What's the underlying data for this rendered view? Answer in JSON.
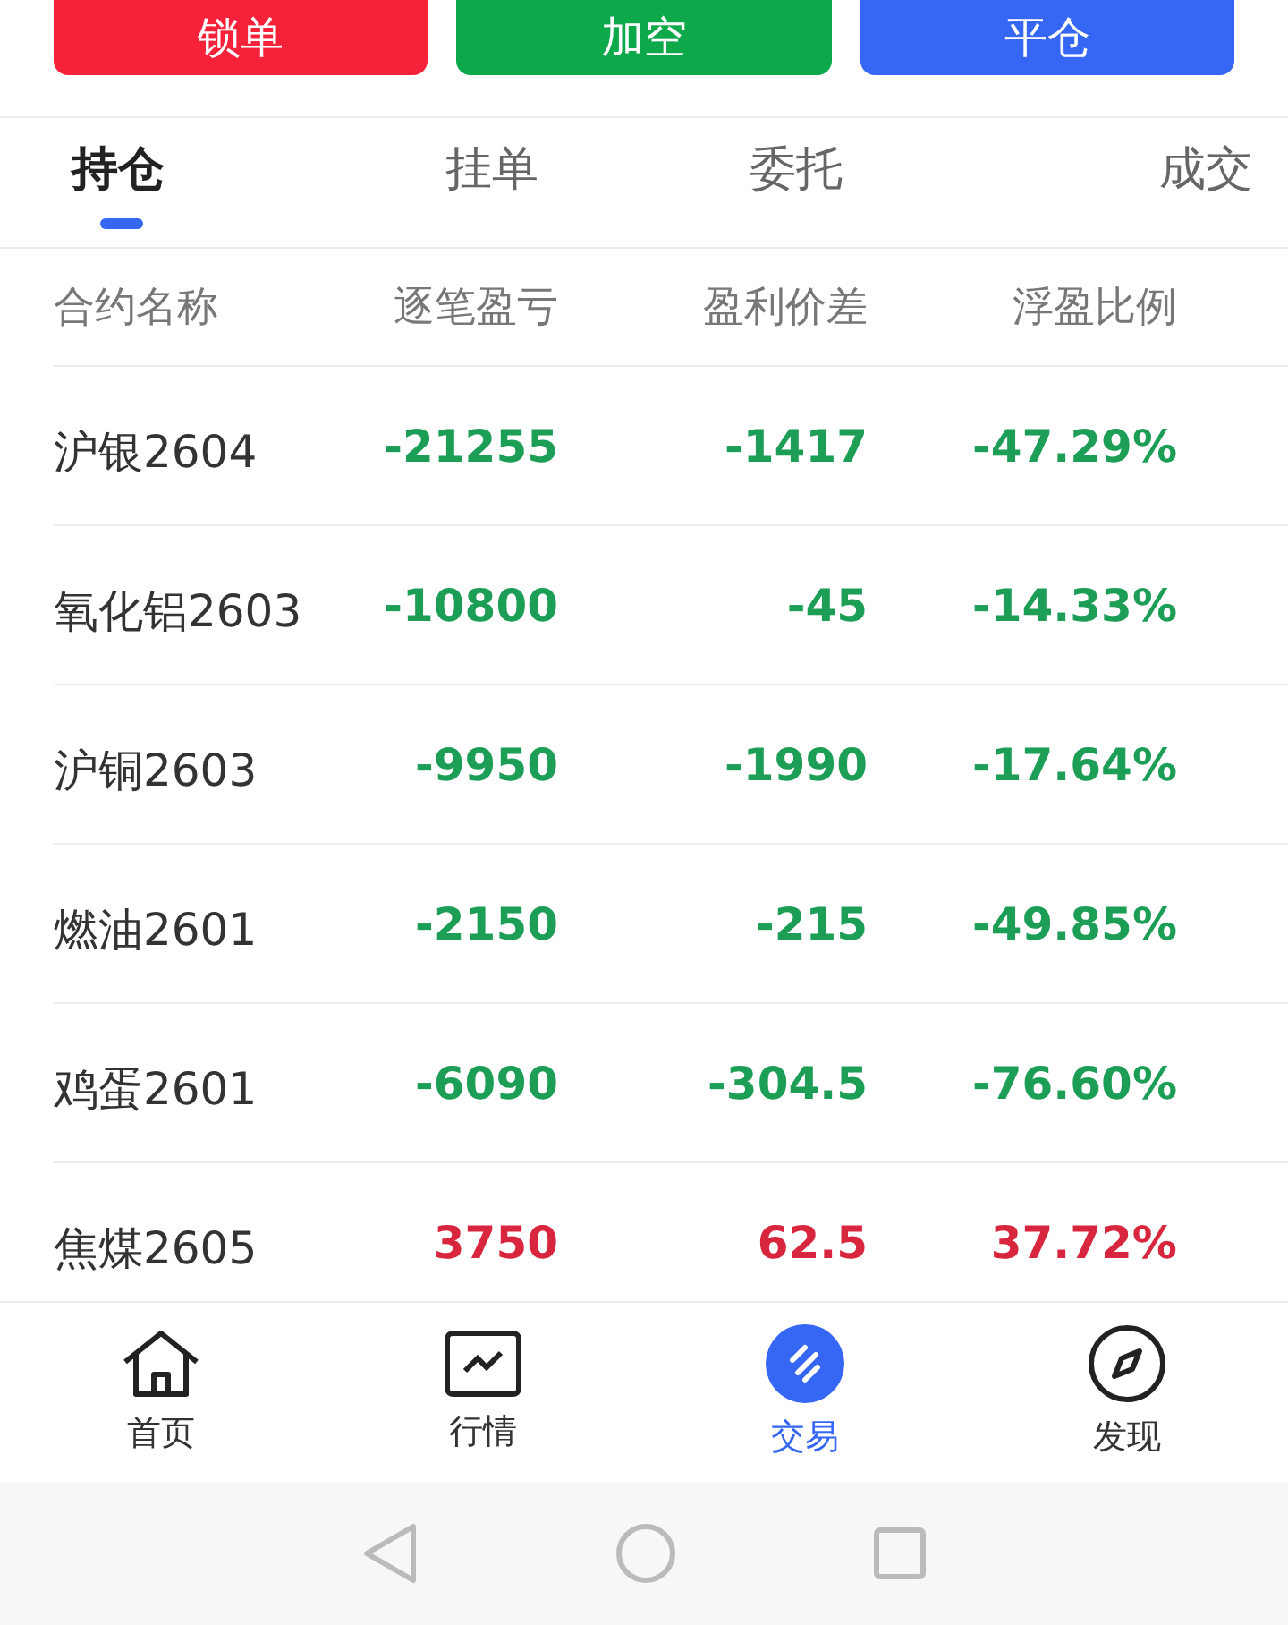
{
  "action_buttons": [
    {
      "label": "锁单",
      "kind": "red"
    },
    {
      "label": "加空",
      "kind": "green"
    },
    {
      "label": "平仓",
      "kind": "blue"
    }
  ],
  "tabs": [
    {
      "label": "持仓",
      "selected": true
    },
    {
      "label": "挂单",
      "selected": false
    },
    {
      "label": "委托",
      "selected": false
    },
    {
      "label": "成交",
      "selected": false
    }
  ],
  "table": {
    "columns": [
      "合约名称",
      "逐笔盈亏",
      "盈利价差",
      "浮盈比例"
    ],
    "rows": [
      {
        "name": "沪银2604",
        "pnl": "-21255",
        "spread": "-1417",
        "ratio": "-47.29%",
        "color": "#1d9e57"
      },
      {
        "name": "氧化铝2603",
        "pnl": "-10800",
        "spread": "-45",
        "ratio": "-14.33%",
        "color": "#1d9e57"
      },
      {
        "name": "沪铜2603",
        "pnl": "-9950",
        "spread": "-1990",
        "ratio": "-17.64%",
        "color": "#1d9e57"
      },
      {
        "name": "燃油2601",
        "pnl": "-2150",
        "spread": "-215",
        "ratio": "-49.85%",
        "color": "#1d9e57"
      },
      {
        "name": "鸡蛋2601",
        "pnl": "-6090",
        "spread": "-304.5",
        "ratio": "-76.60%",
        "color": "#1d9e57"
      },
      {
        "name": "焦煤2605",
        "pnl": "3750",
        "spread": "62.5",
        "ratio": "37.72%",
        "color": "#d7263d"
      }
    ]
  },
  "bottom_nav": [
    {
      "label": "首页",
      "kind": "home",
      "selected": false
    },
    {
      "label": "行情",
      "kind": "market",
      "selected": false
    },
    {
      "label": "交易",
      "kind": "trade",
      "selected": true
    },
    {
      "label": "发现",
      "kind": "discover",
      "selected": false
    }
  ],
  "system_bar": [
    {
      "kind": "back"
    },
    {
      "kind": "home"
    },
    {
      "kind": "recents"
    }
  ]
}
